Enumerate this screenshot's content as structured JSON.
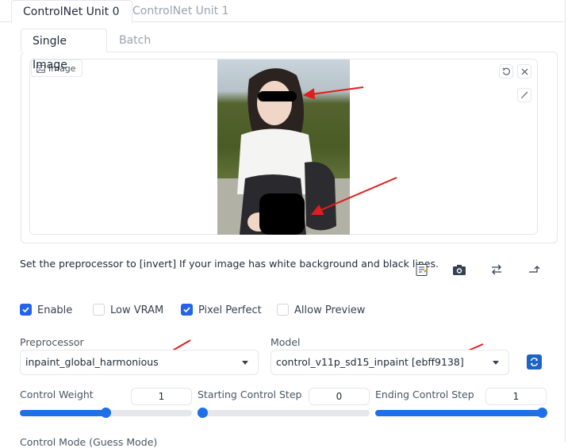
{
  "outer_tabs": [
    "ControlNet Unit 0",
    "ControlNet Unit 1"
  ],
  "inner_tabs": [
    "Single Image",
    "Batch"
  ],
  "image_panel": {
    "label": "Image"
  },
  "hint": "Set the preprocessor to [invert] If your image has white background and black lines.",
  "toolbar_icons": [
    "notepad-icon",
    "camera-icon",
    "swap-icon",
    "send-dimensions-icon"
  ],
  "checkboxes": [
    {
      "label": "Enable",
      "checked": true
    },
    {
      "label": "Low VRAM",
      "checked": false
    },
    {
      "label": "Pixel Perfect",
      "checked": true
    },
    {
      "label": "Allow Preview",
      "checked": false
    }
  ],
  "preprocessor": {
    "label": "Preprocessor",
    "value": "inpaint_global_harmonious"
  },
  "model": {
    "label": "Model",
    "value": "control_v11p_sd15_inpaint [ebff9138]"
  },
  "sliders": [
    {
      "label": "Control Weight",
      "value": "1",
      "fraction": 0.5
    },
    {
      "label": "Starting Control Step",
      "value": "0",
      "fraction": 0
    },
    {
      "label": "Ending Control Step",
      "value": "1",
      "fraction": 1
    }
  ],
  "control_mode": {
    "label": "Control Mode (Guess Mode)"
  },
  "colors": {
    "accent": "#2563eb",
    "slider": "#1e6fe8",
    "annotation_arrow": "#e11d1d"
  }
}
